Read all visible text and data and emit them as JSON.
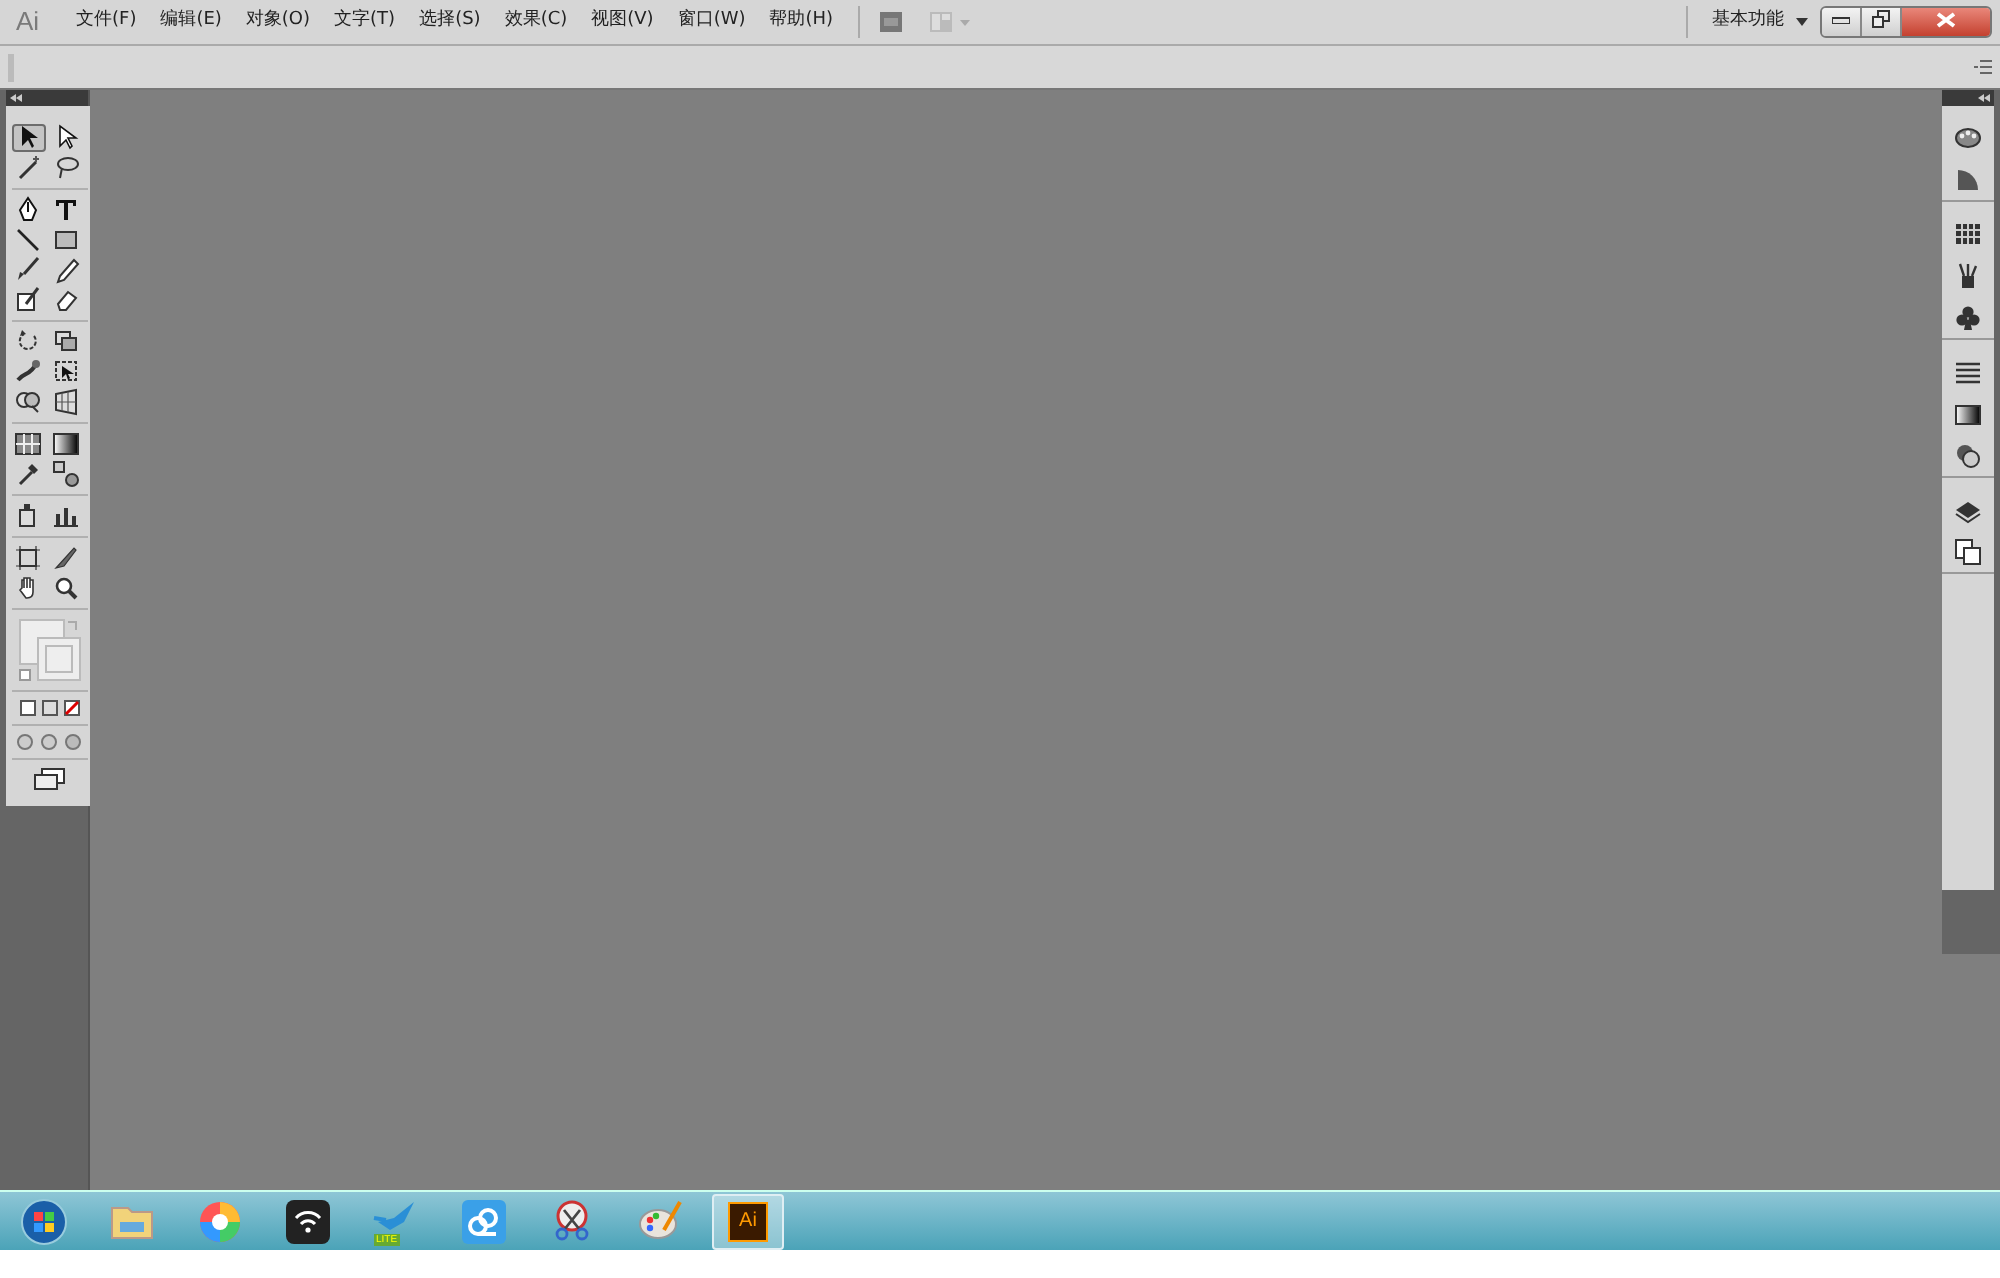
{
  "app_logo": "Ai",
  "menu": [
    "文件(F)",
    "编辑(E)",
    "对象(O)",
    "文字(T)",
    "选择(S)",
    "效果(C)",
    "视图(V)",
    "窗口(W)",
    "帮助(H)"
  ],
  "workspace": {
    "label": "基本功能"
  },
  "tool_groups": [
    [
      {
        "kind": "selection",
        "selected": true
      },
      {
        "kind": "direct-selection",
        "selected": false
      },
      {
        "kind": "magic-wand",
        "selected": false
      },
      {
        "kind": "lasso",
        "selected": false
      }
    ],
    [
      {
        "kind": "pen",
        "selected": false
      },
      {
        "kind": "type",
        "selected": false
      },
      {
        "kind": "line",
        "selected": false
      },
      {
        "kind": "rectangle",
        "selected": false
      },
      {
        "kind": "brush",
        "selected": false
      },
      {
        "kind": "pencil",
        "selected": false
      },
      {
        "kind": "blob-brush",
        "selected": false
      },
      {
        "kind": "eraser",
        "selected": false
      }
    ],
    [
      {
        "kind": "rotate",
        "selected": false
      },
      {
        "kind": "scale",
        "selected": false
      },
      {
        "kind": "warp",
        "selected": false
      },
      {
        "kind": "free-transform",
        "selected": false
      },
      {
        "kind": "shape-builder",
        "selected": false
      },
      {
        "kind": "perspective",
        "selected": false
      }
    ],
    [
      {
        "kind": "mesh",
        "selected": false
      },
      {
        "kind": "gradient",
        "selected": false
      },
      {
        "kind": "eyedropper",
        "selected": false
      },
      {
        "kind": "blend",
        "selected": false
      }
    ],
    [
      {
        "kind": "sprayer",
        "selected": false
      },
      {
        "kind": "graph",
        "selected": false
      }
    ],
    [
      {
        "kind": "artboard",
        "selected": false
      },
      {
        "kind": "slice",
        "selected": false
      },
      {
        "kind": "hand",
        "selected": false
      },
      {
        "kind": "zoom",
        "selected": false
      }
    ]
  ],
  "panel_groups": [
    [
      {
        "kind": "color"
      },
      {
        "kind": "color-guide"
      }
    ],
    [
      {
        "kind": "swatches"
      },
      {
        "kind": "brushes"
      },
      {
        "kind": "symbols"
      }
    ],
    [
      {
        "kind": "stroke"
      },
      {
        "kind": "gradient"
      },
      {
        "kind": "transparency"
      }
    ],
    [
      {
        "kind": "layers"
      },
      {
        "kind": "artboards"
      }
    ]
  ],
  "taskbar": [
    {
      "kind": "start",
      "active": false
    },
    {
      "kind": "folder",
      "active": false
    },
    {
      "kind": "pinwheel",
      "active": false
    },
    {
      "kind": "wifi",
      "active": false
    },
    {
      "kind": "bird",
      "active": false,
      "badge": "LITE"
    },
    {
      "kind": "cloud",
      "active": false
    },
    {
      "kind": "scissors",
      "active": false
    },
    {
      "kind": "palette",
      "active": false
    },
    {
      "kind": "ai",
      "active": true,
      "label": "Ai"
    }
  ]
}
